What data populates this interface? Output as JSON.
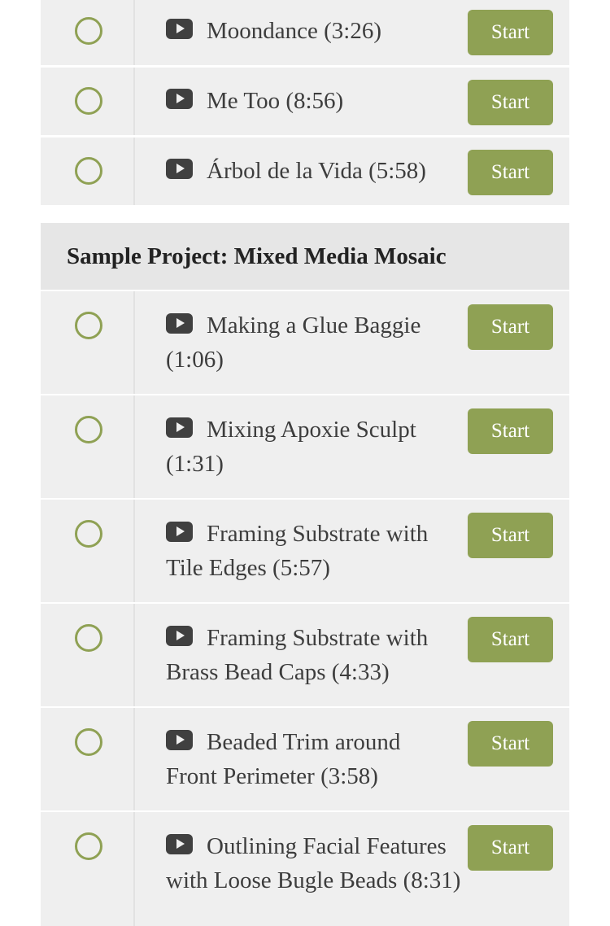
{
  "colors": {
    "accent": "#8fa154",
    "row_bg": "#efefef",
    "section_bg": "#e6e6e6",
    "icon": "#404040"
  },
  "icons": {
    "status": "circle-outline-icon",
    "video": "play-icon"
  },
  "section_1": {
    "lessons": [
      {
        "title": "Moondance (3:26)",
        "button": "Start"
      },
      {
        "title": "Me Too (8:56)",
        "button": "Start"
      },
      {
        "title": "Árbol de la Vida (5:58)",
        "button": "Start"
      }
    ]
  },
  "section_2": {
    "heading": "Sample Project: Mixed Media Mosaic",
    "lessons": [
      {
        "title": "Making a Glue Baggie (1:06)",
        "button": "Start"
      },
      {
        "title": "Mixing Apoxie Sculpt (1:31)",
        "button": "Start"
      },
      {
        "title": "Framing Substrate with Tile Edges (5:57)",
        "button": "Start"
      },
      {
        "title": "Framing Substrate with Brass Bead Caps (4:33)",
        "button": "Start"
      },
      {
        "title": "Beaded Trim around Front Perimeter (3:58)",
        "button": "Start"
      },
      {
        "title": "Outlining Facial Features with Loose Bugle Beads (8:31)",
        "button": "Start"
      }
    ]
  }
}
